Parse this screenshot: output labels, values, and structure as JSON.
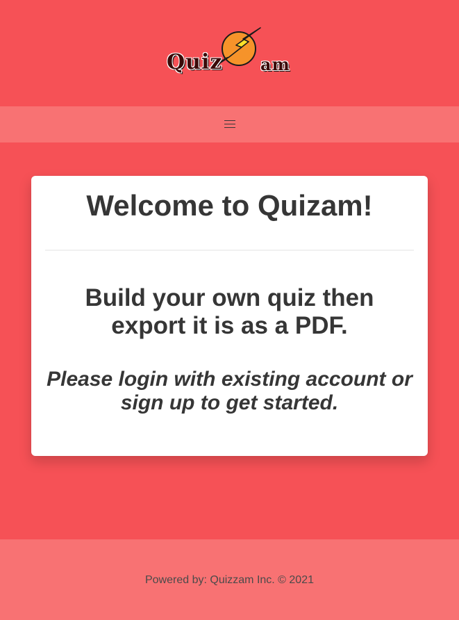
{
  "colors": {
    "page_background": "#f65156",
    "navbar_background": "#f87273",
    "footer_background": "#f87273",
    "card_background": "#ffffff",
    "text": "#363636",
    "logo_bolt_fill": "#fbe22a",
    "logo_circle_fill": "#f6932a"
  },
  "brand": {
    "logo_text_left": "Quiz",
    "logo_text_right": "am",
    "logo_icon": "lightning-bolt-icon"
  },
  "navbar": {
    "menu_icon": "hamburger-menu-icon"
  },
  "card": {
    "title": "Welcome to Quizam!",
    "subtitle": "Build your own quiz then export it is as a PDF.",
    "cta": "Please login with existing account or sign up to get started."
  },
  "footer": {
    "text": "Powered by: Quizzam Inc. © 2021"
  }
}
